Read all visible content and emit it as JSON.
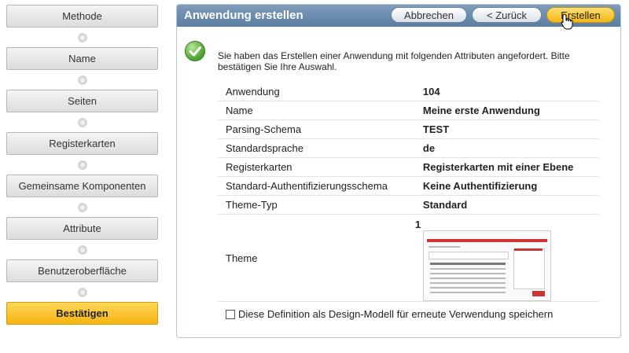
{
  "wizard": {
    "steps": [
      {
        "label": "Methode"
      },
      {
        "label": "Name"
      },
      {
        "label": "Seiten"
      },
      {
        "label": "Registerkarten"
      },
      {
        "label": "Gemeinsame Komponenten"
      },
      {
        "label": "Attribute"
      },
      {
        "label": "Benutzeroberfläche"
      },
      {
        "label": "Bestätigen"
      }
    ]
  },
  "panel": {
    "title": "Anwendung erstellen",
    "buttons": {
      "cancel": "Abbrechen",
      "back": "< Zurück",
      "create": "Erstellen"
    }
  },
  "message": "Sie haben das Erstellen einer Anwendung mit folgenden Attributen angefordert. Bitte bestätigen Sie Ihre Auswahl.",
  "attributes": [
    {
      "label": "Anwendung",
      "value": "104"
    },
    {
      "label": "Name",
      "value": "Meine erste Anwendung"
    },
    {
      "label": "Parsing-Schema",
      "value": "TEST"
    },
    {
      "label": "Standardsprache",
      "value": "de"
    },
    {
      "label": "Registerkarten",
      "value": "Registerkarten mit einer Ebene"
    },
    {
      "label": "Standard-Authentifizierungsschema",
      "value": "Keine Authentifizierung"
    },
    {
      "label": "Theme-Typ",
      "value": "Standard"
    }
  ],
  "theme": {
    "label": "Theme",
    "value": "1"
  },
  "save_checkbox": {
    "label": "Diese Definition als Design-Modell für erneute Verwendung speichern",
    "checked": false
  },
  "colors": {
    "header": "#6a8aad",
    "active_step": "#f7bf22",
    "create_button": "#f7c531"
  }
}
